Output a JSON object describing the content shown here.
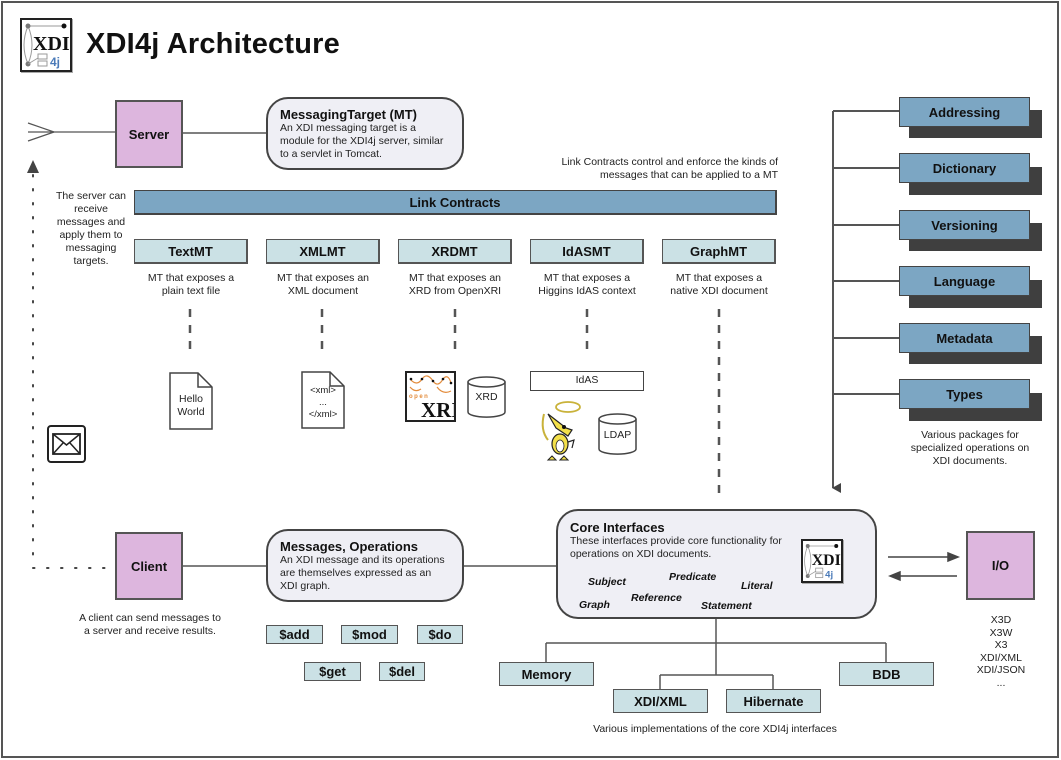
{
  "title": "XDI4j Architecture",
  "logo": {
    "icon": "xdi4j-logo-icon",
    "text_main": "XDI",
    "text_sub": "4j",
    "accent": "#4a7ab8"
  },
  "colors": {
    "node_fill": "#ddb6de",
    "bubble_fill": "#efeff5",
    "mt_fill": "#cbe1e5",
    "package_fill": "#7ca6c3",
    "package_shadow": "#3f3f3f",
    "line": "#555555"
  },
  "server": {
    "label": "Server",
    "note": "The server can receive messages and apply them to messaging targets."
  },
  "messaging_target": {
    "title": "MessagingTarget (MT)",
    "body": "An XDI messaging target is a module for the XDI4j server, similar to a servlet in Tomcat."
  },
  "link_contracts": {
    "label": "Link Contracts",
    "note_line1": "Link Contracts control and enforce the kinds of",
    "note_line2": "messages that can be applied to a MT"
  },
  "mts": [
    {
      "label": "TextMT",
      "desc1": "MT that exposes a",
      "desc2": "plain text file"
    },
    {
      "label": "XMLMT",
      "desc1": "MT that exposes an",
      "desc2": "XML document"
    },
    {
      "label": "XRDMT",
      "desc1": "MT that exposes an",
      "desc2": "XRD from OpenXRI"
    },
    {
      "label": "IdASMT",
      "desc1": "MT that exposes a",
      "desc2": "Higgins IdAS context"
    },
    {
      "label": "GraphMT",
      "desc1": "MT that exposes a",
      "desc2": "native XDI document"
    }
  ],
  "artifacts": {
    "text_doc": {
      "line1": "Hello",
      "line2": "World"
    },
    "xml_doc": {
      "line1": "<xml>",
      "line2": "...",
      "line3": "</xml>"
    },
    "openxri_logo": {
      "icon": "openxri-logo-icon",
      "small": "open",
      "big": "XRI"
    },
    "xrd_store": "XRD",
    "idas_box": "IdAS",
    "higgins_mascot": "higgins-mascot-icon",
    "ldap_store": "LDAP"
  },
  "envelope": {
    "icon": "envelope-icon"
  },
  "client": {
    "label": "Client",
    "note_line1": "A client can send messages to",
    "note_line2": "a server and receive results."
  },
  "messages": {
    "title": "Messages, Operations",
    "body": "An XDI message and its operations are themselves expressed as an XDI graph."
  },
  "operations": [
    "$add",
    "$mod",
    "$do",
    "$get",
    "$del"
  ],
  "core": {
    "title": "Core Interfaces",
    "body": "These interfaces provide core functionality for operations on XDI documents.",
    "terms": [
      "Subject",
      "Predicate",
      "Literal",
      "Graph",
      "Reference",
      "Statement"
    ]
  },
  "packages": {
    "items": [
      "Addressing",
      "Dictionary",
      "Versioning",
      "Language",
      "Metadata",
      "Types"
    ],
    "note": "Various packages for specialized operations on XDI documents."
  },
  "io": {
    "label": "I/O",
    "formats": [
      "X3D",
      "X3W",
      "X3",
      "XDI/XML",
      "XDI/JSON",
      "..."
    ]
  },
  "implementations": {
    "items": [
      "Memory",
      "XDI/XML",
      "Hibernate",
      "BDB"
    ],
    "note": "Various implementations of the core XDI4j interfaces"
  }
}
